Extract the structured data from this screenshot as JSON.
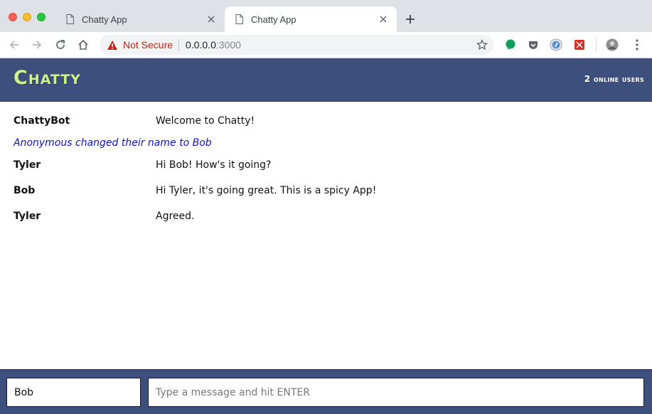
{
  "browser": {
    "tabs": [
      {
        "title": "Chatty App",
        "active": false
      },
      {
        "title": "Chatty App",
        "active": true
      }
    ],
    "address": {
      "security_label": "Not Secure",
      "host": "0.0.0.0",
      "port": ":3000"
    }
  },
  "app": {
    "brand": "Chatty",
    "online_users": "2 online users"
  },
  "messages": [
    {
      "type": "message",
      "username": "ChattyBot",
      "content": "Welcome to Chatty!"
    },
    {
      "type": "notification",
      "content": "Anonymous changed their name to Bob"
    },
    {
      "type": "message",
      "username": "Tyler",
      "content": "Hi Bob! How's it going?"
    },
    {
      "type": "message",
      "username": "Bob",
      "content": "Hi Tyler, it's going great. This is a spicy App!"
    },
    {
      "type": "message",
      "username": "Tyler",
      "content": "Agreed."
    }
  ],
  "chatbar": {
    "username_value": "Bob",
    "message_placeholder": "Type a message and hit ENTER"
  },
  "colors": {
    "header_bg": "#3d4f7c",
    "brand": "#cdf28c",
    "notification": "#1010d6",
    "insecure": "#c5221f"
  }
}
